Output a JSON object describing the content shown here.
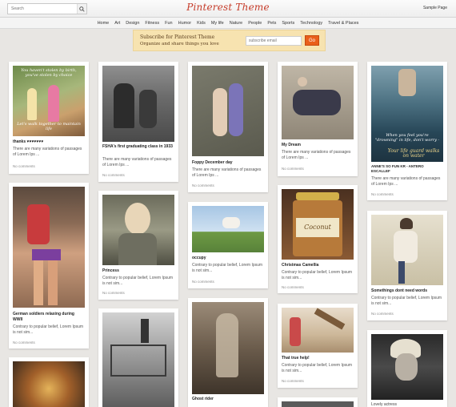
{
  "header": {
    "search_placeholder": "Search",
    "logo": "Pinterest Theme",
    "sample_page": "Sample Page"
  },
  "nav": [
    "Home",
    "Art",
    "Design",
    "Fitness",
    "Fun",
    "Humor",
    "Kids",
    "My life",
    "Nature",
    "People",
    "Pets",
    "Sports",
    "Technology",
    "Travel & Places"
  ],
  "subscribe": {
    "title": "Subscribe for Pinterest Theme",
    "subtitle": "Organize and share things you love",
    "email_placeholder": "subscribe email",
    "go_label": "Go"
  },
  "pins": {
    "p1": {
      "title": "thanks ♥♥♥♥♥♥♥",
      "desc": "There are many variations of passages of Lorem Ips ...",
      "comments": "No comments",
      "overlay_top": "You haven't stolen by birth, you've stolen by choice",
      "overlay_bottom": "Let's walk together to maintain life"
    },
    "p2": {
      "title": "German soldiers relaxing during WWII",
      "desc": "Contrary to popular belief, Lorem Ipsum is not sim...",
      "comments": "No comments"
    },
    "p3": {
      "title": "FSHA's first graduating class in 1933",
      "desc": "There are many variations of passages of Lorem Ips ...",
      "comments": "No comments"
    },
    "p4": {
      "title": "Princess",
      "desc": "Contrary to popular belief, Lorem Ipsum is not sim...",
      "comments": "No comments"
    },
    "p5": {
      "title": "Foppy December day",
      "desc": "There are many variations of passages of Lorem Ips ...",
      "comments": "No comments"
    },
    "p6": {
      "title": "occupy",
      "desc": "Contrary to popular belief, Lorem Ipsum is not sim...",
      "comments": "No comments"
    },
    "p7": {
      "title": "Ghost rider"
    },
    "p8": {
      "title": "My Dream",
      "desc": "There are many variations of passages of Lorem Ips ...",
      "comments": "No comments"
    },
    "p9": {
      "title": "Christmas Camellia",
      "desc": "Contrary to popular belief, Lorem Ipsum is not sim...",
      "comments": "No comments",
      "jar_label": "Coconut"
    },
    "p10": {
      "title": "That true help!",
      "desc": "Contrary to popular belief, Lorem Ipsum is not sim...",
      "comments": "No comments"
    },
    "p11": {
      "title": "ANNE'S SO FUN KR - ANTERO ESCALLEF",
      "desc": "There are many variations of passages of Lorem Ips ...",
      "comments": "No comments",
      "overlay_top": "When you feel you're \"drowning\" in life, don't worry -",
      "overlay_bottom": "Your life guard walks on water"
    },
    "p12": {
      "title": "Somethings dont need words",
      "desc": "Contrary to popular belief, Lorem Ipsum is not sim...",
      "comments": "No comments"
    },
    "p13": {
      "title": "Lovely actress"
    }
  }
}
